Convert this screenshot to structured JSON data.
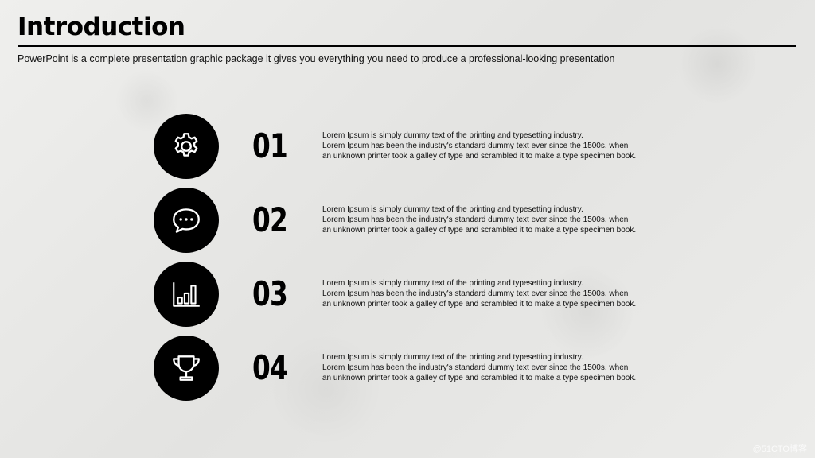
{
  "slide": {
    "title": "Introduction",
    "subtitle": "PowerPoint is a complete presentation graphic package it gives you everything you need to produce a professional-looking presentation"
  },
  "items": [
    {
      "number": "01",
      "icon": "gear-icon",
      "lines": [
        "Lorem Ipsum is simply dummy text of the printing and typesetting industry.",
        "Lorem Ipsum has been the industry's standard dummy text ever since the 1500s, when",
        "an unknown printer took a galley of type and scrambled it to make a type specimen book."
      ]
    },
    {
      "number": "02",
      "icon": "chat-bubble-icon",
      "lines": [
        "Lorem Ipsum is simply dummy text of the printing and typesetting industry.",
        "Lorem Ipsum has been the industry's standard dummy text ever since the 1500s, when",
        "an unknown printer took a galley of type and scrambled it to make a type specimen book."
      ]
    },
    {
      "number": "03",
      "icon": "bar-chart-icon",
      "lines": [
        "Lorem Ipsum is simply dummy text of the printing and typesetting industry.",
        "Lorem Ipsum has been the industry's standard dummy text ever since the 1500s, when",
        "an unknown printer took a galley of type and scrambled it to make a type specimen book."
      ]
    },
    {
      "number": "04",
      "icon": "trophy-icon",
      "lines": [
        "Lorem Ipsum is simply dummy text of the printing and typesetting industry.",
        "Lorem Ipsum has been the industry's standard dummy text ever since the 1500s, when",
        "an unknown printer took a galley of type and scrambled it to make a type specimen book."
      ]
    }
  ],
  "watermark": "@51CTO博客",
  "colors": {
    "circle": "#000000",
    "icon_stroke": "#ffffff",
    "text": "#111111"
  }
}
